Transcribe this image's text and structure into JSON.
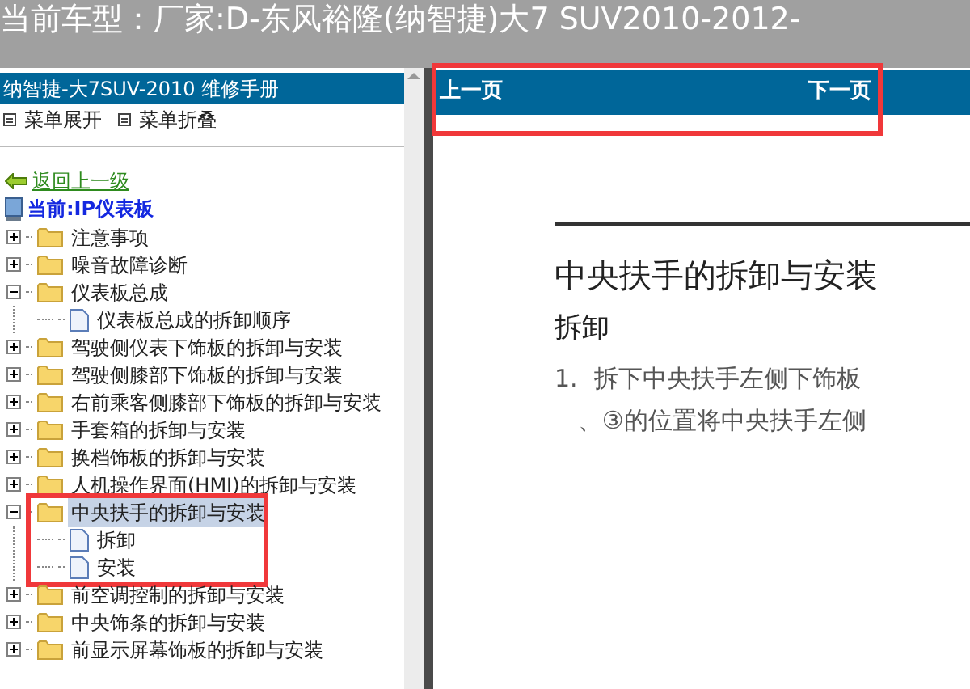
{
  "window": {
    "title": "当前车型：厂家:D-东风裕隆(纳智捷)大7 SUV2010-2012-"
  },
  "sidebar": {
    "header": "纳智捷-大7SUV-2010 维修手册",
    "menu_actions": [
      "菜单展开",
      "菜单折叠"
    ],
    "back_link": "返回上一级",
    "current": "当前:IP仪表板",
    "tree": [
      {
        "kind": "folder",
        "label": "注意事项",
        "expanded": false,
        "selected": false
      },
      {
        "kind": "folder",
        "label": "噪音故障诊断",
        "expanded": false,
        "selected": false
      },
      {
        "kind": "folder",
        "label": "仪表板总成",
        "expanded": true,
        "selected": false,
        "children": [
          {
            "kind": "page",
            "label": "仪表板总成的拆卸顺序",
            "selected": false
          }
        ]
      },
      {
        "kind": "folder",
        "label": "驾驶侧仪表下饰板的拆卸与安装",
        "expanded": false,
        "selected": false
      },
      {
        "kind": "folder",
        "label": "驾驶侧膝部下饰板的拆卸与安装",
        "expanded": false,
        "selected": false
      },
      {
        "kind": "folder",
        "label": "右前乘客侧膝部下饰板的拆卸与安装",
        "expanded": false,
        "selected": false
      },
      {
        "kind": "folder",
        "label": "手套箱的拆卸与安装",
        "expanded": false,
        "selected": false
      },
      {
        "kind": "folder",
        "label": "换档饰板的拆卸与安装",
        "expanded": false,
        "selected": false
      },
      {
        "kind": "folder",
        "label": "人机操作界面(HMI)的拆卸与安装",
        "expanded": false,
        "selected": false
      },
      {
        "kind": "folder",
        "label": "中央扶手的拆卸与安装",
        "expanded": true,
        "selected": true,
        "children": [
          {
            "kind": "page",
            "label": "拆卸",
            "selected": false
          },
          {
            "kind": "page",
            "label": "安装",
            "selected": false
          }
        ]
      },
      {
        "kind": "folder",
        "label": "前空调控制的拆卸与安装",
        "expanded": false,
        "selected": false
      },
      {
        "kind": "folder",
        "label": "中央饰条的拆卸与安装",
        "expanded": false,
        "selected": false
      },
      {
        "kind": "folder",
        "label": "前显示屏幕饰板的拆卸与安装",
        "expanded": false,
        "selected": false
      }
    ]
  },
  "pager": {
    "previous": "上一页",
    "next": "下一页"
  },
  "document": {
    "title": "中央扶手的拆卸与安装",
    "section": "拆卸",
    "steps": [
      {
        "number": "1.",
        "lines": [
          "拆下中央扶手左侧下饰板",
          "、③的位置将中央扶手左侧"
        ]
      }
    ]
  }
}
